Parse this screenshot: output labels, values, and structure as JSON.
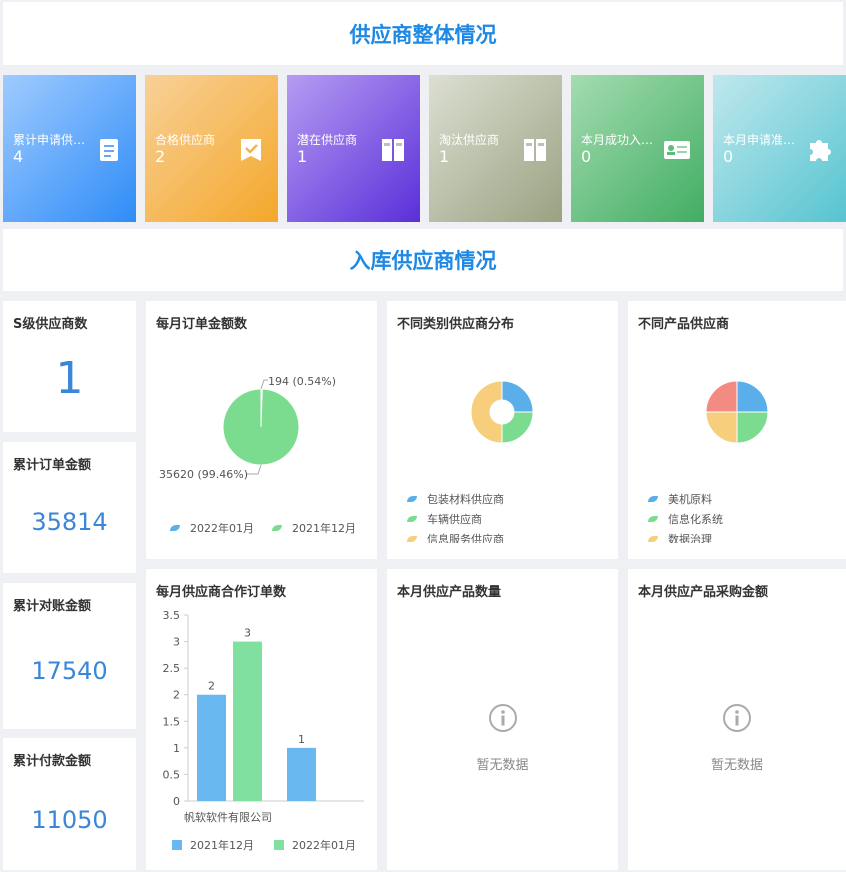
{
  "header": {
    "title": "供应商整体情况",
    "section2_title": "入库供应商情况"
  },
  "kpis": [
    {
      "label": "累计申请供应商",
      "value": "4",
      "icon": "document-icon",
      "color_from": "#9fcbff",
      "color_to": "#2f8cf7"
    },
    {
      "label": "合格供应商",
      "value": "2",
      "icon": "approved-check-icon",
      "color_from": "#f8d198",
      "color_to": "#f4a72a"
    },
    {
      "label": "潜在供应商",
      "value": "1",
      "icon": "binder-icon",
      "color_from": "#b69cf2",
      "color_to": "#5a2fd9"
    },
    {
      "label": "淘汰供应商",
      "value": "1",
      "icon": "binder-icon",
      "color_from": "#dcdfd2",
      "color_to": "#9aa282"
    },
    {
      "label": "本月成功入库供应商",
      "value": "0",
      "icon": "id-card-icon",
      "color_from": "#a4dcb0",
      "color_to": "#41ad63"
    },
    {
      "label": "本月申请准入供应商",
      "value": "0",
      "icon": "puzzle-icon",
      "color_from": "#bfe8ee",
      "color_to": "#56c4d0"
    }
  ],
  "stats": [
    {
      "label": "S级供应商数",
      "value": "1"
    },
    {
      "label": "累计订单金额",
      "value": "35814"
    },
    {
      "label": "累计对账金额",
      "value": "17540"
    },
    {
      "label": "累计付款金额",
      "value": "11050"
    }
  ],
  "cards": {
    "monthly_order_amount": "每月订单金额数",
    "category_distribution": "不同类别供应商分布",
    "product_suppliers": "不同产品供应商",
    "monthly_coop_orders": "每月供应商合作订单数",
    "monthly_product_qty": "本月供应产品数量",
    "monthly_purchase_amount": "本月供应产品采购金额"
  },
  "empty_text": "暂无数据",
  "chart_data": [
    {
      "type": "pie",
      "title": "每月订单金额数",
      "slices": [
        {
          "name": "2022年01月",
          "value": 194,
          "label": "194 (0.54%)",
          "color": "#5aaeea"
        },
        {
          "name": "2021年12月",
          "value": 35620,
          "label": "35620 (99.46%)",
          "color": "#7bdc8f"
        }
      ]
    },
    {
      "type": "pie",
      "title": "不同类别供应商分布",
      "donut": true,
      "slices": [
        {
          "name": "包装材料供应商",
          "value": 1,
          "color": "#5aaeea"
        },
        {
          "name": "车辆供应商",
          "value": 1,
          "color": "#7bdc8f"
        },
        {
          "name": "信息服务供应商",
          "value": 2,
          "color": "#f7ce7c"
        }
      ]
    },
    {
      "type": "pie",
      "title": "不同产品供应商",
      "slices": [
        {
          "name": "美机原料",
          "value": 1,
          "color": "#5aaeea"
        },
        {
          "name": "信息化系统",
          "value": 1,
          "color": "#7bdc8f"
        },
        {
          "name": "数据治理",
          "value": 1,
          "color": "#f7ce7c"
        },
        {
          "name": "",
          "value": 1,
          "color": "#f38b83"
        }
      ]
    },
    {
      "type": "bar",
      "title": "每月供应商合作订单数",
      "categories": [
        "帆软软件有限公司"
      ],
      "series": [
        {
          "name": "2021年12月",
          "values": [
            2
          ],
          "color": "#6ab8f0"
        },
        {
          "name": "2022年01月",
          "values": [
            3
          ],
          "color": "#7fe0a0"
        }
      ],
      "extra_bar": {
        "value": 1,
        "color": "#6ab8f0"
      },
      "yticks": [
        "0",
        "0.5",
        "1",
        "1.5",
        "2",
        "2.5",
        "3",
        "3.5"
      ],
      "ylim": [
        0,
        3.5
      ]
    }
  ]
}
